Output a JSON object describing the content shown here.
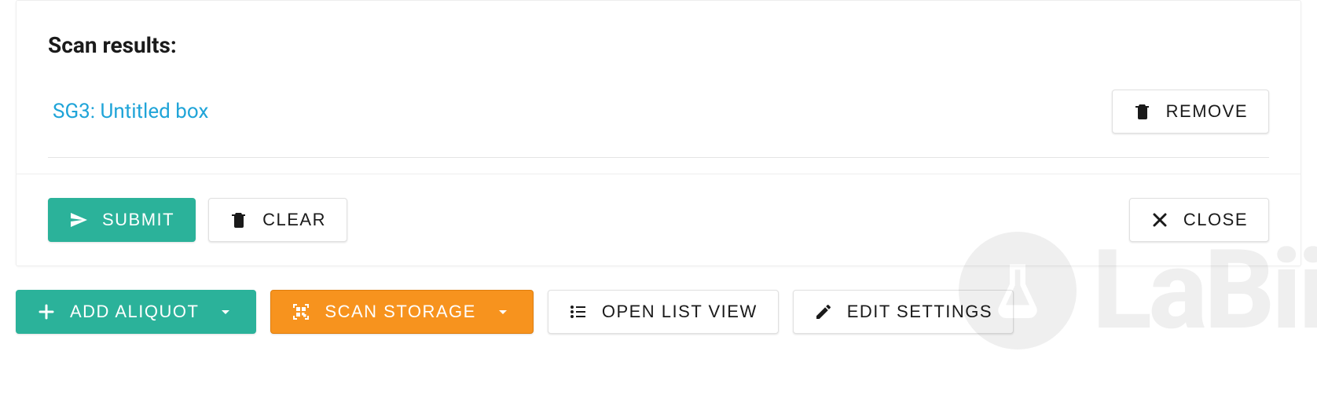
{
  "panel": {
    "title": "Scan results:",
    "result": {
      "label": "SG3: Untitled box",
      "remove_label": "REMOVE"
    },
    "footer": {
      "submit_label": "SUBMIT",
      "clear_label": "CLEAR",
      "close_label": "CLOSE"
    }
  },
  "toolbar": {
    "add_aliquot_label": "ADD ALIQUOT",
    "scan_storage_label": "SCAN STORAGE",
    "open_list_label": "OPEN LIST VIEW",
    "edit_settings_label": "EDIT SETTINGS"
  },
  "watermark": {
    "text": "LaBii"
  }
}
